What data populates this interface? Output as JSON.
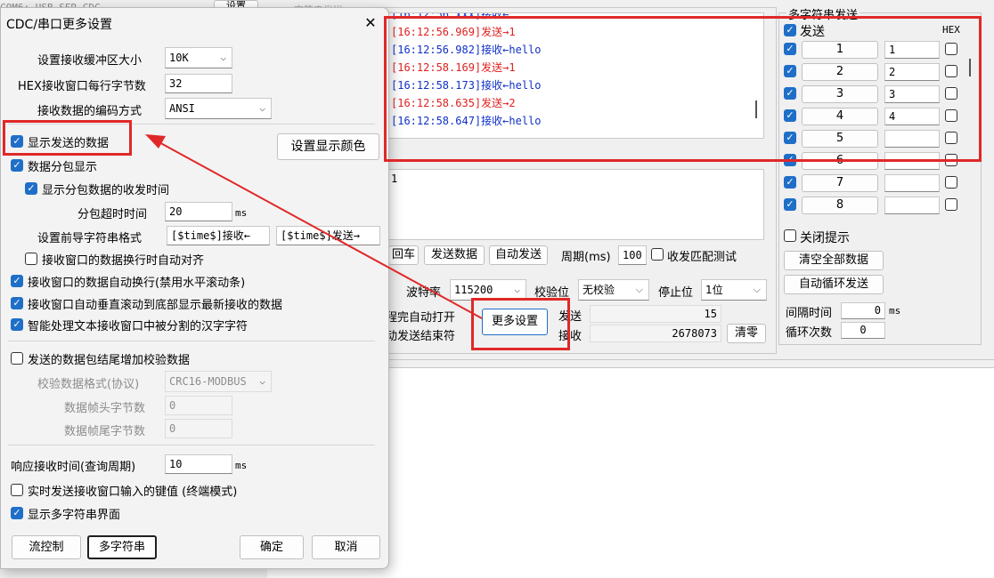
{
  "bg": {
    "top_left_fragment": "COM6: USB-SER-CDC",
    "top_btn_fragment": "设置",
    "frame_title_fragment": "字符串发送"
  },
  "dialog": {
    "title": "CDC/串口更多设置",
    "close": "✕",
    "recv_buffer_label": "设置接收缓冲区大小",
    "recv_buffer_value": "10K",
    "hex_bytes_label": "HEX接收窗口每行字节数",
    "hex_bytes_value": "32",
    "encoding_label": "接收数据的编码方式",
    "encoding_value": "ANSI",
    "show_sent_label": "显示发送的数据",
    "display_color_btn": "设置显示颜色",
    "packet_label": "数据分包显示",
    "packet_time_label": "显示分包数据的收发时间",
    "packet_timeout_label": "分包超时时间",
    "packet_timeout_value": "20",
    "packet_timeout_unit": "ms",
    "prefix_label": "设置前导字符串格式",
    "prefix_recv": "[$time$]接收←",
    "prefix_send": "[$time$]发送→",
    "align_label": "接收窗口的数据换行时自动对齐",
    "wrap_label": "接收窗口的数据自动换行(禁用水平滚动条)",
    "autoscroll_label": "接收窗口自动垂直滚动到底部显示最新接收的数据",
    "smart_label": "智能处理文本接收窗口中被分割的汉字字符",
    "checksum_label": "发送的数据包结尾增加校验数据",
    "checksum_format_label": "校验数据格式(协议)",
    "checksum_format_value": "CRC16-MODBUS",
    "head_bytes_label": "数据帧头字节数",
    "head_bytes_value": "0",
    "tail_bytes_label": "数据帧尾字节数",
    "tail_bytes_value": "0",
    "resp_label": "响应接收时间(查询周期)",
    "resp_value": "10",
    "resp_unit": "ms",
    "realtime_label": "实时发送接收窗口输入的键值 (终端模式)",
    "multistring_label": "显示多字符串界面",
    "flow_btn": "流控制",
    "multi_btn": "多字符串",
    "ok_btn": "确定",
    "cancel_btn": "取消"
  },
  "log": [
    {
      "text": "[16:12:56.969]发送→1",
      "color": "red"
    },
    {
      "text": "[16:12:56.982]接收←hello",
      "color": "blue"
    },
    {
      "text": "[16:12:58.169]发送→1",
      "color": "red"
    },
    {
      "text": "[16:12:58.173]接收←hello",
      "color": "blue"
    },
    {
      "text": "[16:12:58.635]发送→2",
      "color": "red"
    },
    {
      "text": "[16:12:58.647]接收←hello",
      "color": "blue"
    }
  ],
  "send_input_value": "1",
  "main": {
    "cr_btn": "回车",
    "send_btn": "发送数据",
    "auto_send_btn": "自动发送",
    "period_label": "周期(ms)",
    "period_value": "100",
    "match_label": "收发匹配测试",
    "baud_label": "波特率",
    "baud_value": "115200",
    "parity_label": "校验位",
    "parity_value": "无校验",
    "stop_label": "停止位",
    "stop_value": "1位",
    "auto_open_label": "编程完自动打开",
    "auto_send_end_label": "自动发送结束符",
    "more_btn": "更多设置",
    "sent_label": "发送",
    "sent_value": "15",
    "recv_label": "接收",
    "recv_value": "2678073",
    "clear_btn": "清零"
  },
  "multi": {
    "title": "多字符串发送",
    "send_header": "发送",
    "hex_header": "HEX",
    "rows": [
      {
        "num": "1",
        "val": "1",
        "on": true
      },
      {
        "num": "2",
        "val": "2",
        "on": true
      },
      {
        "num": "3",
        "val": "3",
        "on": true
      },
      {
        "num": "4",
        "val": "4",
        "on": true
      },
      {
        "num": "5",
        "val": "",
        "on": true
      },
      {
        "num": "6",
        "val": "",
        "on": true
      },
      {
        "num": "7",
        "val": "",
        "on": true
      },
      {
        "num": "8",
        "val": "",
        "on": true
      }
    ],
    "close_tip_label": "关闭提示",
    "clear_all_btn": "清空全部数据",
    "auto_loop_btn": "自动循环发送",
    "interval_label": "间隔时间",
    "interval_value": "0",
    "interval_unit": "ms",
    "loop_label": "循环次数",
    "loop_value": "0"
  },
  "colors": {
    "highlight": "#e02828",
    "check": "#1f6fc8",
    "send_text": "#e02020",
    "recv_text": "#1030c8"
  }
}
